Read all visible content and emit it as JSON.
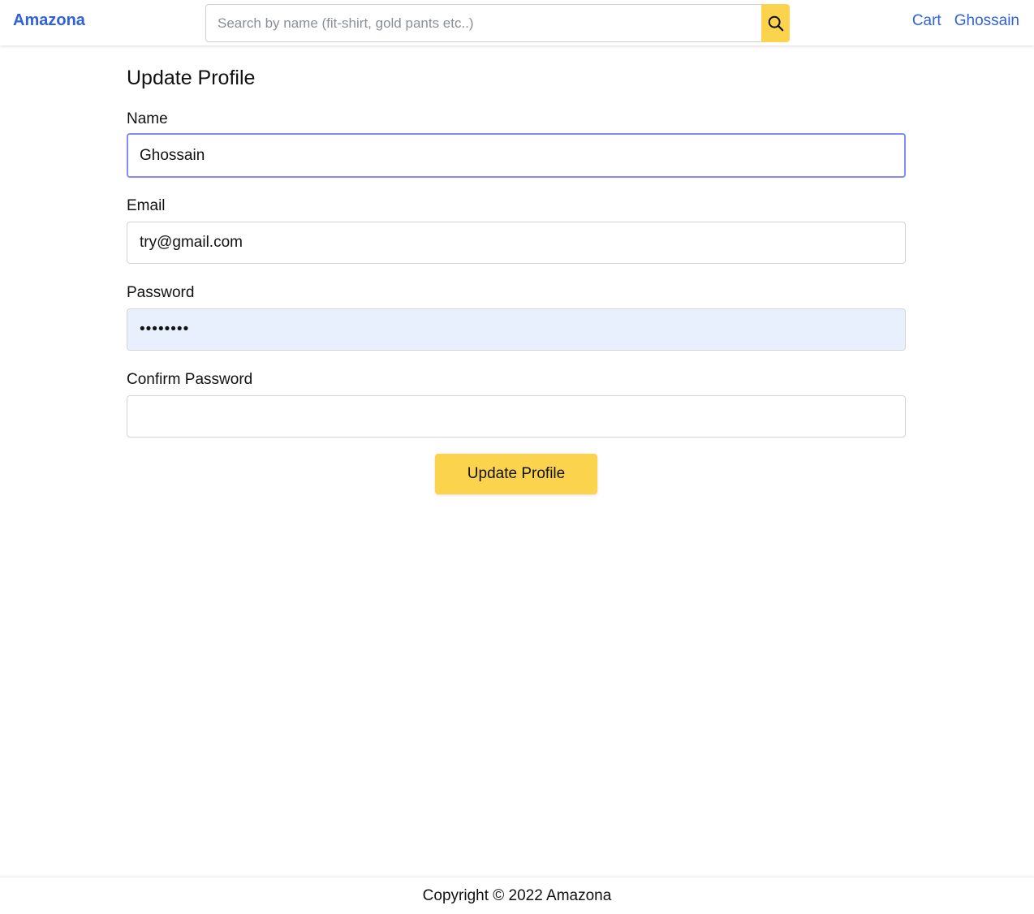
{
  "header": {
    "brand": "Amazona",
    "search": {
      "placeholder": "Search by name (fit-shirt, gold pants etc..)",
      "value": "",
      "button_icon": "search-icon"
    },
    "nav": {
      "cart": "Cart",
      "user": "Ghossain"
    }
  },
  "main": {
    "title": "Update Profile",
    "fields": {
      "name": {
        "label": "Name",
        "value": "Ghossain"
      },
      "email": {
        "label": "Email",
        "value": "try@gmail.com"
      },
      "password": {
        "label": "Password",
        "value": "••••••••"
      },
      "confirm_password": {
        "label": "Confirm Password",
        "value": ""
      }
    },
    "submit_label": "Update Profile"
  },
  "footer": {
    "text": "Copyright © 2022 Amazona"
  },
  "colors": {
    "brand": "#2f62d9",
    "accent": "#fcd34d",
    "focus_ring": "#818cf8",
    "autofill_bg": "#e8f0fe"
  }
}
